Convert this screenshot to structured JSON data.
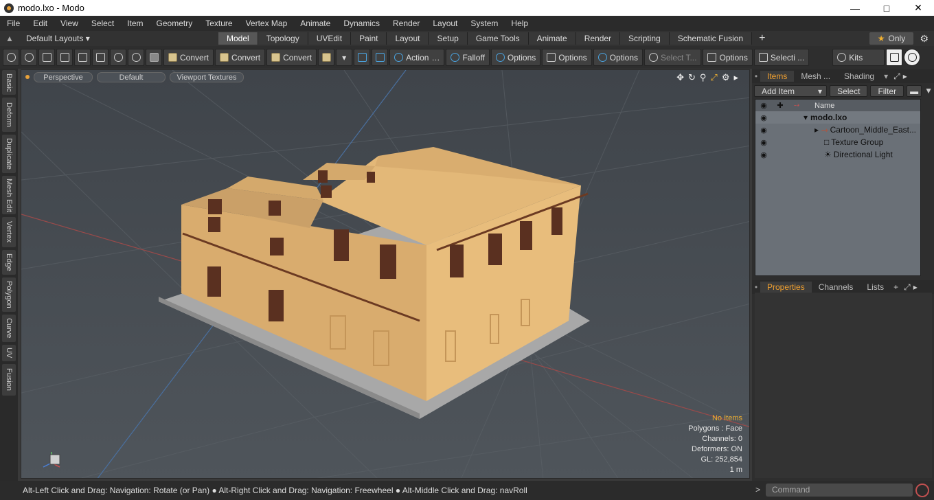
{
  "window": {
    "title": "modo.lxo - Modo"
  },
  "menu": [
    "File",
    "Edit",
    "View",
    "Select",
    "Item",
    "Geometry",
    "Texture",
    "Vertex Map",
    "Animate",
    "Dynamics",
    "Render",
    "Layout",
    "System",
    "Help"
  ],
  "layoutbar": {
    "layouts": "Default Layouts",
    "tabs": [
      "Model",
      "Topology",
      "UVEdit",
      "Paint",
      "Layout",
      "Setup",
      "Game Tools",
      "Animate",
      "Render",
      "Scripting",
      "Schematic Fusion"
    ],
    "active_tab": "Model",
    "only": "Only"
  },
  "toolbar": {
    "convert1": "Convert",
    "convert2": "Convert",
    "convert3": "Convert",
    "action": "Action",
    "falloff": "Falloff",
    "options1": "Options",
    "options2": "Options",
    "options3": "Options",
    "select_t": "Select T...",
    "options4": "Options",
    "selecti": "Selecti ...",
    "kits": "Kits"
  },
  "left_tabs": [
    "Basic",
    "Deform",
    "Duplicate",
    "Mesh Edit",
    "Vertex",
    "Edge",
    "Polygon",
    "Curve",
    "UV",
    "Fusion"
  ],
  "viewport": {
    "view": "Perspective",
    "style": "Default",
    "textures": "Viewport Textures",
    "hud": {
      "items": "No Items",
      "polygons": "Polygons : Face",
      "channels": "Channels: 0",
      "deformers": "Deformers: ON",
      "gl": "GL: 252,854",
      "scale": "1 m"
    }
  },
  "items_panel": {
    "tabs": [
      "Items",
      "Mesh ...",
      "Shading"
    ],
    "add_item": "Add Item",
    "select": "Select",
    "filter": "Filter",
    "col_name": "Name",
    "tree": [
      {
        "label": "modo.lxo"
      },
      {
        "label": "Cartoon_Middle_East..."
      },
      {
        "label": "Texture Group"
      },
      {
        "label": "Directional Light"
      }
    ]
  },
  "props_panel": {
    "tabs": [
      "Properties",
      "Channels",
      "Lists"
    ]
  },
  "status": {
    "hint": "Alt-Left Click and Drag: Navigation: Rotate (or Pan) ● Alt-Right Click and Drag: Navigation: Freewheel ● Alt-Middle Click and Drag: navRoll",
    "command_placeholder": "Command"
  }
}
